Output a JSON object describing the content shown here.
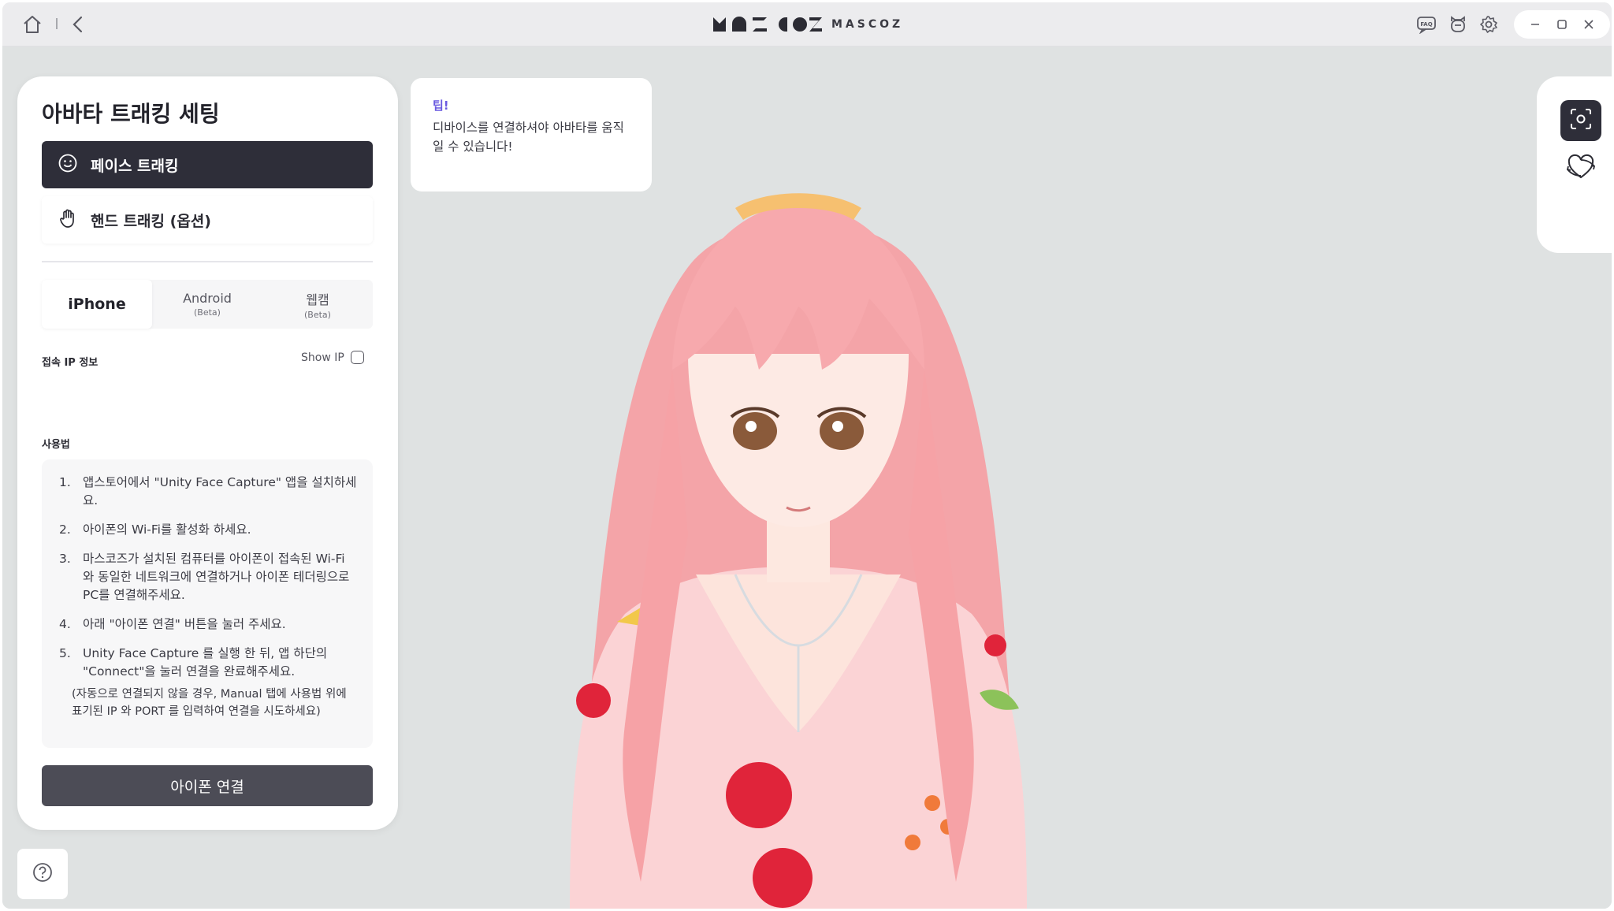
{
  "app": {
    "brand_text": "MASCOZ"
  },
  "panel": {
    "title": "아바타 트래킹 세팅",
    "modes": [
      {
        "label": "페이스 트래킹",
        "active": true
      },
      {
        "label": "핸드 트래킹 (옵션)",
        "active": false
      }
    ],
    "tabs": [
      {
        "label": "iPhone",
        "sub": "",
        "active": true
      },
      {
        "label": "Android",
        "sub": "(Beta)",
        "active": false
      },
      {
        "label": "웹캠",
        "sub": "(Beta)",
        "active": false
      }
    ],
    "ip_label": "접속 IP 정보",
    "show_ip_label": "Show IP",
    "usage_label": "사용법",
    "steps": [
      {
        "num": "1.",
        "text": "앱스토어에서 \"Unity Face Capture\" 앱을 설치하세요."
      },
      {
        "num": "2.",
        "text": "아이폰의 Wi-Fi를 활성화 하세요."
      },
      {
        "num": "3.",
        "text": "마스코즈가 설치된 컴퓨터를 아이폰이 접속된 Wi-Fi 와 동일한 네트워크에 연결하거나 아이폰 테더링으로 PC를 연결해주세요."
      },
      {
        "num": "4.",
        "text": "아래 \"아이폰 연결\" 버튼을 눌러 주세요."
      },
      {
        "num": "5.",
        "text": "Unity Face Capture 를 실행 한 뒤, 앱 하단의 \"Connect\"을 눌러 연결을 완료해주세요."
      }
    ],
    "note": "(자동으로 연결되지 않을 경우, Manual 탭에 사용법 위에 표기된 IP 와 PORT 를 입력하여 연결을 시도하세요)",
    "connect_label": "아이폰 연결"
  },
  "tip": {
    "title": "팁!",
    "text": "디바이스를 연결하셔야 아바타를 움직일 수 있습니다!"
  },
  "colors": {
    "accent_dark": "#2e2e39",
    "tip_accent": "#6a5ae0",
    "stage_bg": "#dfe2e2"
  }
}
